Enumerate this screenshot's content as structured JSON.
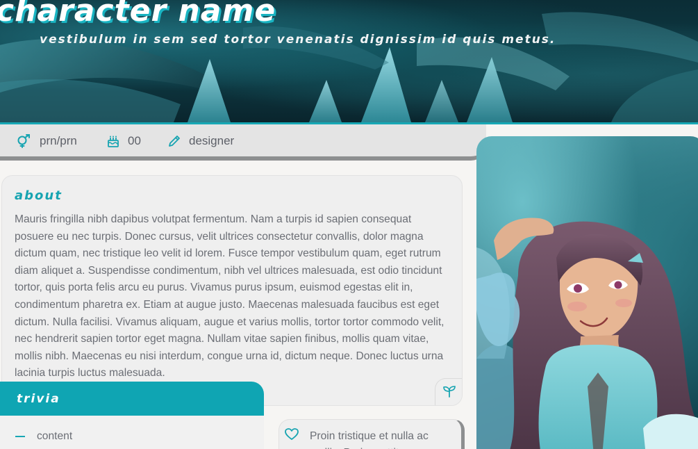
{
  "header": {
    "title": "character name",
    "subtitle": "vestibulum in sem sed tortor venenatis dignissim id quis metus."
  },
  "info": {
    "pronouns": {
      "icon": "gender-icon",
      "label": "prn/prn"
    },
    "age": {
      "icon": "birthday-cake-icon",
      "label": "00"
    },
    "role": {
      "icon": "pencil-icon",
      "label": "designer"
    }
  },
  "about": {
    "title": "about",
    "text": "Mauris fringilla nibh dapibus volutpat fermentum. Nam a turpis id sapien consequat posuere eu nec turpis. Donec cursus, velit ultrices consectetur convallis, dolor magna dictum quam, nec tristique leo velit id lorem. Fusce tempor vestibulum quam, eget rutrum diam aliquet a. Suspendisse condimentum, nibh vel ultrices malesuada, est odio tincidunt tortor, quis porta felis arcu eu purus. Vivamus purus ipsum, euismod egestas elit in, condimentum pharetra ex. Etiam at augue justo. Maecenas malesuada faucibus est eget dictum. Nulla facilisi. Vivamus aliquam, augue et varius mollis, tortor tortor commodo velit, nec hendrerit sapien tortor eget magna. Nullam vitae sapien finibus, mollis quam vitae, mollis nibh. Maecenas eu nisi interdum, congue urna id, dictum neque. Donec luctus urna lacinia turpis luctus malesuada.",
    "corner_icon": "sprout-icon"
  },
  "trivia": {
    "title": "trivia",
    "items": [
      "content"
    ]
  },
  "quote": {
    "icon": "heart-icon",
    "text": "Proin tristique et nulla ac mollis. Proin porttitor"
  },
  "colors": {
    "accent": "#0fa5b3",
    "text": "#6b6e75",
    "card": "#efefef",
    "page": "#f6f5f3"
  }
}
